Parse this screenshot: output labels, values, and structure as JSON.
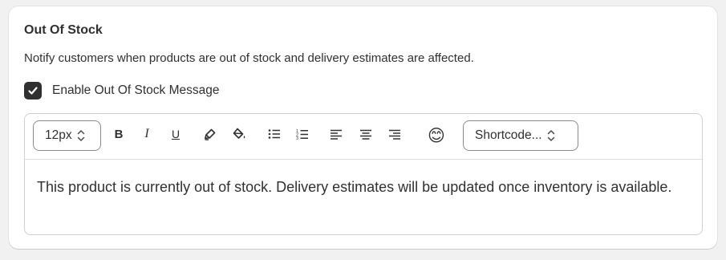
{
  "section": {
    "title": "Out Of Stock",
    "description": "Notify customers when products are out of stock and delivery estimates are affected."
  },
  "enable_checkbox": {
    "label": "Enable Out Of Stock Message",
    "checked": true
  },
  "toolbar": {
    "font_size": "12px",
    "bold_label": "B",
    "italic_label": "I",
    "underline_label": "U",
    "emoji": "😊",
    "shortcode": "Shortcode...",
    "icons": [
      "highlight-icon",
      "fill-color-icon",
      "bullet-list-icon",
      "numbered-list-icon",
      "align-left-icon",
      "align-center-icon",
      "align-right-icon",
      "emoji-icon"
    ]
  },
  "editor": {
    "content": "This product is currently out of stock. Delivery estimates will be updated once inventory is available."
  },
  "colors": {
    "checkbox": "#303030",
    "text": "#303030",
    "border": "#d0d0d0"
  }
}
